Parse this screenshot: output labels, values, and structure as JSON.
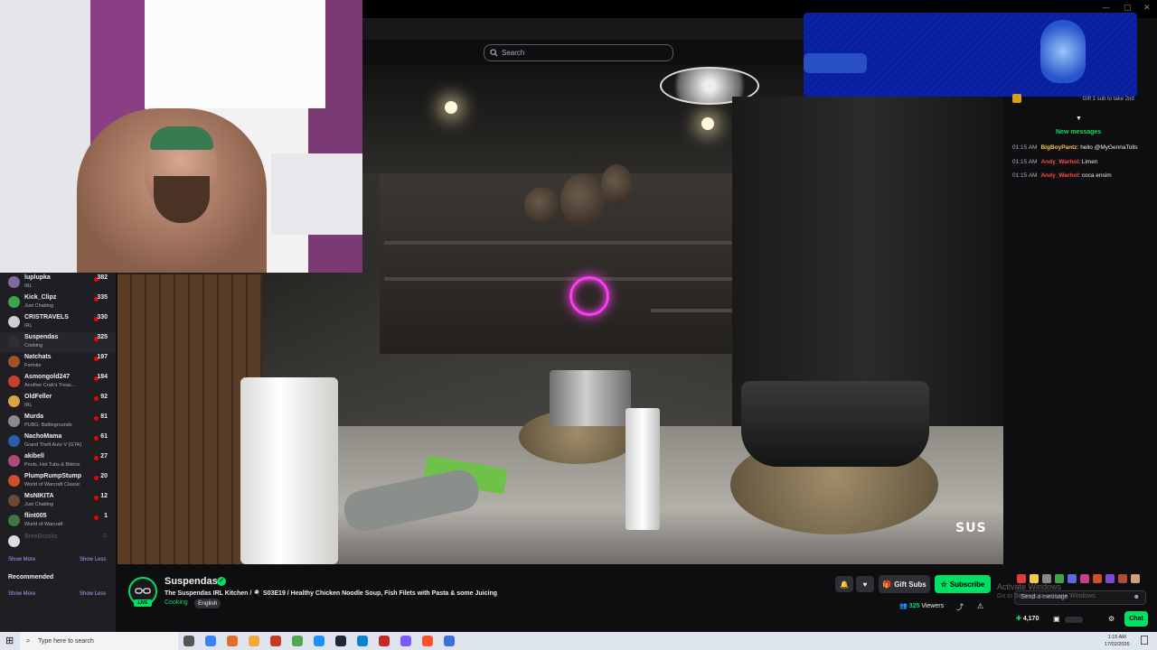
{
  "search": {
    "placeholder": "Search"
  },
  "sidebar": {
    "channels": [
      {
        "name": "luplupka",
        "game": "IRL",
        "viewers": "382",
        "color": "#7c6a9e"
      },
      {
        "name": "Kick_Clipz",
        "game": "Just Chatting",
        "viewers": "335",
        "color": "#3fa34d"
      },
      {
        "name": "CRISTRAVELS",
        "game": "IRL",
        "viewers": "330",
        "color": "#cfcfcf"
      },
      {
        "name": "Suspendas",
        "game": "Cooking",
        "viewers": "325",
        "color": "#2f2f35"
      },
      {
        "name": "Natchats",
        "game": "Fortnite",
        "viewers": "197",
        "color": "#a0522d"
      },
      {
        "name": "Asmongold247",
        "game": "Another Crab's Treas...",
        "viewers": "184",
        "color": "#c93f2d"
      },
      {
        "name": "OldFeller",
        "game": "IRL",
        "viewers": "92",
        "color": "#d9a441"
      },
      {
        "name": "Murda",
        "game": "PUBG: Battlegrounds",
        "viewers": "81",
        "color": "#8a8a8a"
      },
      {
        "name": "NachoMama",
        "game": "Grand Theft Auto V (GTA)",
        "viewers": "61",
        "color": "#2a5ea8"
      },
      {
        "name": "akibell",
        "game": "Pools, Hot Tubs & Bikinis",
        "viewers": "27",
        "color": "#b04a7a"
      },
      {
        "name": "PlumpRumpStump",
        "game": "World of Warcraft Classic",
        "viewers": "20",
        "color": "#d04f2b"
      },
      {
        "name": "MsNIKITA",
        "game": "Just Chatting",
        "viewers": "12",
        "color": "#6c4a3a"
      },
      {
        "name": "flint005",
        "game": "World of Warcraft",
        "viewers": "1",
        "color": "#3d7a3d"
      }
    ],
    "offline_channel": {
      "name": "BreeBrooks",
      "badge": "ᶻᶻ"
    },
    "show_more": "Show More",
    "show_less": "Show Less",
    "recommended_title": "Recommended",
    "show_more_2": "Show More",
    "show_less_2": "Show Less"
  },
  "stream": {
    "channel_name": "Suspendas",
    "title": "The Suspendas IRL Kitchen / 🍳 S03E19 / Healthy Chicken Noodle Soup, Fish Filets with Pasta & some Juicing",
    "category": "Cooking",
    "tag": "English",
    "live_label": "LIVE",
    "gift_subs_label": "Gift Subs",
    "subscribe_label": "Subscribe",
    "viewers_count": "325",
    "viewers_label": "Viewers",
    "watermark": "SUS"
  },
  "chat": {
    "pinned_text": "Gift 1 sub to take 2nd",
    "new_messages_label": "New messages",
    "messages": [
      {
        "time": "01:15 AM",
        "user": "BigBoyPantz",
        "user_color": "#f2c94c",
        "text": "hello @MyGennaTolls"
      },
      {
        "time": "01:15 AM",
        "user": "Andy_Warhol",
        "user_color": "#ff4a4a",
        "text": "Limen"
      },
      {
        "time": "01:15 AM",
        "user": "Andy_Warhol",
        "user_color": "#ff4a4a",
        "text": "coca ensim"
      }
    ],
    "input_placeholder": "Send a message",
    "chat_button": "Chat",
    "points": "4,170"
  },
  "windows": {
    "activate_title": "Activate Windows",
    "activate_sub": "Go to Settings to activate Windows.",
    "taskbar_search": "Type here to search",
    "time": "1:15 AM",
    "date": "17/02/2026"
  },
  "colors": {
    "accent": "#00e065",
    "bg": "#0e0e10",
    "panel": "#1f1f23"
  }
}
